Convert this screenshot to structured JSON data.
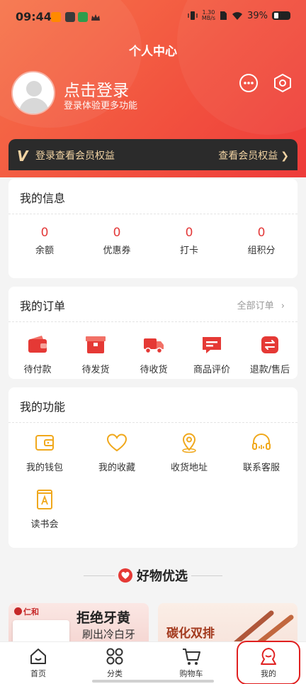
{
  "status_bar": {
    "time": "09:44",
    "net_speed_value": "1.30",
    "net_speed_unit": "MB/s",
    "battery": "39%"
  },
  "header": {
    "title": "个人中心",
    "login_title": "点击登录",
    "login_subtitle": "登录体验更多功能"
  },
  "member_bar": {
    "left_text": "登录查看会员权益",
    "right_text": "查看会员权益"
  },
  "my_info": {
    "title": "我的信息",
    "items": [
      {
        "value": "0",
        "label": "余额"
      },
      {
        "value": "0",
        "label": "优惠券"
      },
      {
        "value": "0",
        "label": "打卡"
      },
      {
        "value": "0",
        "label": "组积分"
      }
    ]
  },
  "my_orders": {
    "title": "我的订单",
    "all_orders": "全部订单",
    "items": [
      {
        "icon": "wallet-icon",
        "label": "待付款"
      },
      {
        "icon": "package-icon",
        "label": "待发货"
      },
      {
        "icon": "truck-icon",
        "label": "待收货"
      },
      {
        "icon": "comment-icon",
        "label": "商品评价"
      },
      {
        "icon": "refund-icon",
        "label": "退款/售后"
      }
    ]
  },
  "my_functions": {
    "title": "我的功能",
    "items": [
      {
        "icon": "wallet-icon",
        "label": "我的钱包"
      },
      {
        "icon": "heart-icon",
        "label": "我的收藏"
      },
      {
        "icon": "location-icon",
        "label": "收货地址"
      },
      {
        "icon": "headset-icon",
        "label": "联系客服"
      },
      {
        "icon": "book-icon",
        "label": "读书会"
      }
    ]
  },
  "selection": {
    "title": "好物优选"
  },
  "banners": [
    {
      "brand": "仁和",
      "headline": "拒绝牙黄",
      "subline": "刷出冷白牙"
    },
    {
      "headline": "碳化双排"
    }
  ],
  "tab_bar": {
    "items": [
      {
        "icon": "home-icon",
        "label": "首页"
      },
      {
        "icon": "category-icon",
        "label": "分类"
      },
      {
        "icon": "cart-icon",
        "label": "购物车"
      },
      {
        "icon": "profile-icon",
        "label": "我的"
      }
    ],
    "active_index": 3
  },
  "colors": {
    "header_gradient_start": "#f6744a",
    "header_gradient_end": "#ee3b3a",
    "accent_red": "#e33a3a",
    "gold_icon": "#f0a81c",
    "member_bar_bg": "#2b2b2b",
    "member_bar_text": "#f1d3a3"
  }
}
